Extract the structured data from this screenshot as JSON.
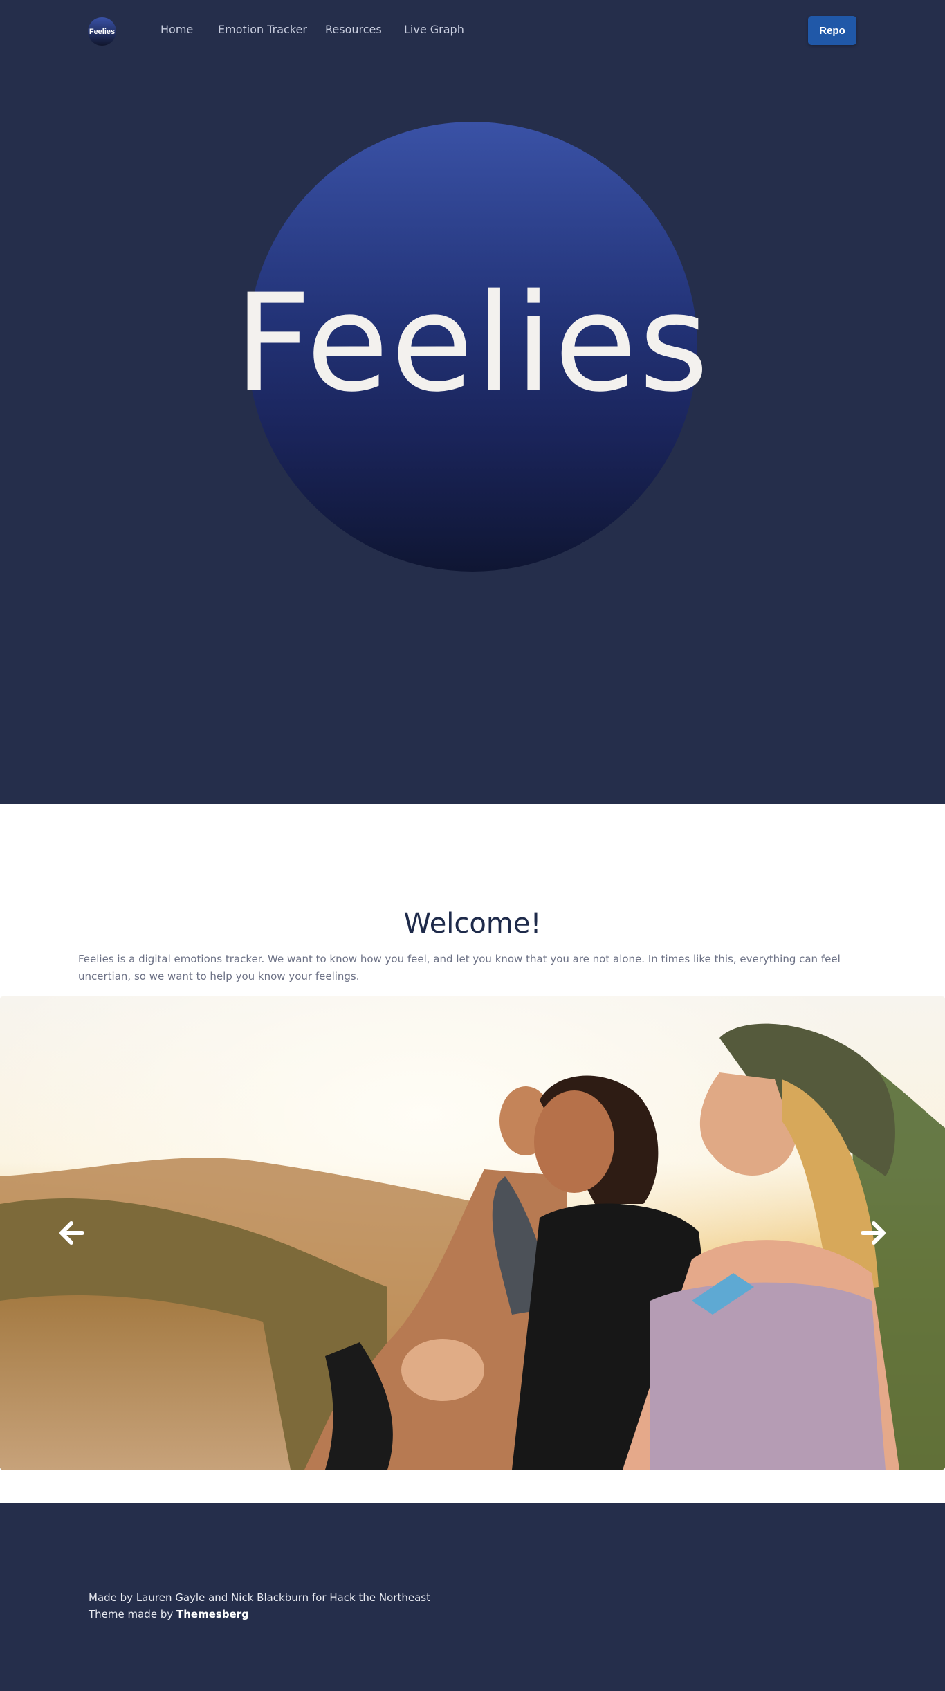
{
  "nav": {
    "logo_text": "Feelies",
    "links": [
      {
        "label": "Home"
      },
      {
        "label": "Emotion Tracker"
      },
      {
        "label": "Resources"
      },
      {
        "label": "Live Graph"
      }
    ],
    "repo_label": "Repo"
  },
  "hero": {
    "title": "Feelies"
  },
  "welcome": {
    "heading": "Welcome!",
    "text": "Feelies is a digital emotions tracker. We want to know how you feel, and let you know that you are not alone. In times like this, everything can feel uncertian, so we want to help you know your feelings."
  },
  "carousel": {
    "prev_icon": "arrow-left-icon",
    "next_icon": "arrow-right-icon"
  },
  "footer": {
    "credit": "Made by Lauren Gayle and Nick Blackburn for Hack the Northeast",
    "theme_prefix": "Theme made by ",
    "theme_link": "Themesberg"
  },
  "colors": {
    "hero_bg": "#252e4b",
    "button": "#2058a8",
    "heading": "#1e2a4a"
  }
}
